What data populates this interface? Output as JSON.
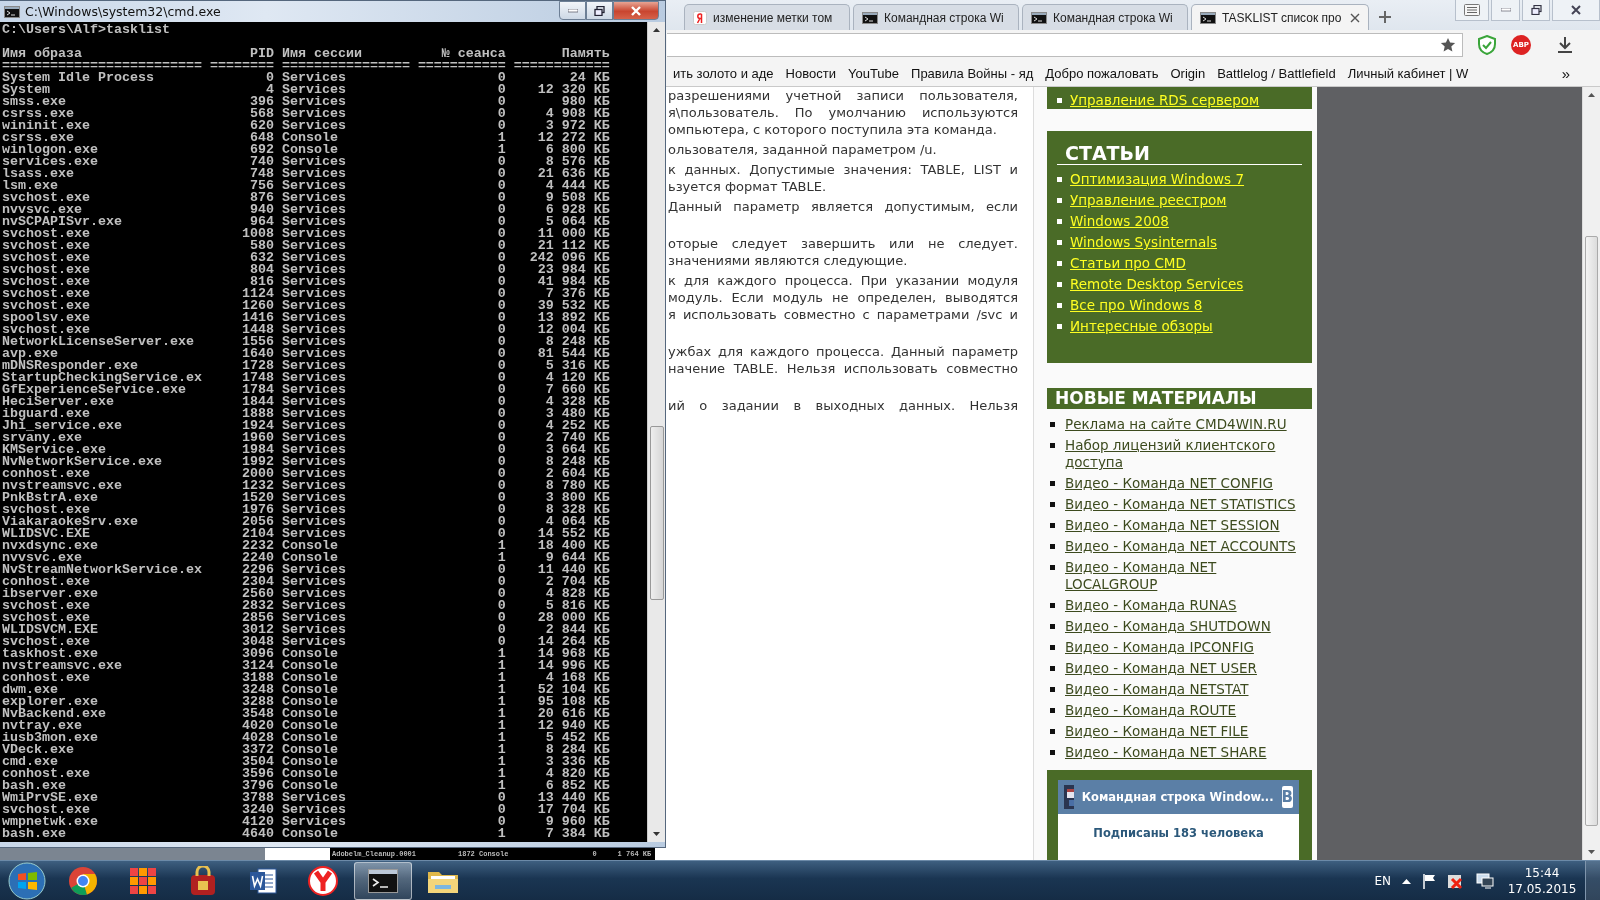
{
  "cmd_window": {
    "title": "C:\\Windows\\system32\\cmd.exe",
    "prompt": "C:\\Users\\Alf>tasklist",
    "columns": [
      "Имя образа",
      "PID",
      "Имя сессии",
      "№ сеанса",
      "Память"
    ],
    "separators": [
      "=========================",
      "========",
      "================",
      "===========",
      "============"
    ],
    "rows": [
      {
        "image": "System Idle Process",
        "pid": "0",
        "session": "Services",
        "session_no": "0",
        "memory": "24 КБ"
      },
      {
        "image": "System",
        "pid": "4",
        "session": "Services",
        "session_no": "0",
        "memory": "12 320 КБ"
      },
      {
        "image": "smss.exe",
        "pid": "396",
        "session": "Services",
        "session_no": "0",
        "memory": "980 КБ"
      },
      {
        "image": "csrss.exe",
        "pid": "568",
        "session": "Services",
        "session_no": "0",
        "memory": "4 908 КБ"
      },
      {
        "image": "wininit.exe",
        "pid": "620",
        "session": "Services",
        "session_no": "0",
        "memory": "3 972 КБ"
      },
      {
        "image": "csrss.exe",
        "pid": "648",
        "session": "Console",
        "session_no": "1",
        "memory": "12 272 КБ"
      },
      {
        "image": "winlogon.exe",
        "pid": "692",
        "session": "Console",
        "session_no": "1",
        "memory": "6 800 КБ"
      },
      {
        "image": "services.exe",
        "pid": "740",
        "session": "Services",
        "session_no": "0",
        "memory": "8 576 КБ"
      },
      {
        "image": "lsass.exe",
        "pid": "748",
        "session": "Services",
        "session_no": "0",
        "memory": "21 636 КБ"
      },
      {
        "image": "lsm.exe",
        "pid": "756",
        "session": "Services",
        "session_no": "0",
        "memory": "4 444 КБ"
      },
      {
        "image": "svchost.exe",
        "pid": "876",
        "session": "Services",
        "session_no": "0",
        "memory": "9 508 КБ"
      },
      {
        "image": "nvvsvc.exe",
        "pid": "940",
        "session": "Services",
        "session_no": "0",
        "memory": "6 928 КБ"
      },
      {
        "image": "nvSCPAPISvr.exe",
        "pid": "964",
        "session": "Services",
        "session_no": "0",
        "memory": "5 064 КБ"
      },
      {
        "image": "svchost.exe",
        "pid": "1008",
        "session": "Services",
        "session_no": "0",
        "memory": "11 000 КБ"
      },
      {
        "image": "svchost.exe",
        "pid": "580",
        "session": "Services",
        "session_no": "0",
        "memory": "21 112 КБ"
      },
      {
        "image": "svchost.exe",
        "pid": "632",
        "session": "Services",
        "session_no": "0",
        "memory": "242 096 КБ"
      },
      {
        "image": "svchost.exe",
        "pid": "804",
        "session": "Services",
        "session_no": "0",
        "memory": "23 984 КБ"
      },
      {
        "image": "svchost.exe",
        "pid": "816",
        "session": "Services",
        "session_no": "0",
        "memory": "41 984 КБ"
      },
      {
        "image": "svchost.exe",
        "pid": "1124",
        "session": "Services",
        "session_no": "0",
        "memory": "7 376 КБ"
      },
      {
        "image": "svchost.exe",
        "pid": "1260",
        "session": "Services",
        "session_no": "0",
        "memory": "39 532 КБ"
      },
      {
        "image": "spoolsv.exe",
        "pid": "1416",
        "session": "Services",
        "session_no": "0",
        "memory": "13 892 КБ"
      },
      {
        "image": "svchost.exe",
        "pid": "1448",
        "session": "Services",
        "session_no": "0",
        "memory": "12 004 КБ"
      },
      {
        "image": "NetworkLicenseServer.exe",
        "pid": "1556",
        "session": "Services",
        "session_no": "0",
        "memory": "8 248 КБ"
      },
      {
        "image": "avp.exe",
        "pid": "1640",
        "session": "Services",
        "session_no": "0",
        "memory": "81 544 КБ"
      },
      {
        "image": "mDNSResponder.exe",
        "pid": "1728",
        "session": "Services",
        "session_no": "0",
        "memory": "5 316 КБ"
      },
      {
        "image": "StartupCheckingService.ex",
        "pid": "1748",
        "session": "Services",
        "session_no": "0",
        "memory": "4 120 КБ"
      },
      {
        "image": "GfExperienceService.exe",
        "pid": "1784",
        "session": "Services",
        "session_no": "0",
        "memory": "7 660 КБ"
      },
      {
        "image": "HeciServer.exe",
        "pid": "1844",
        "session": "Services",
        "session_no": "0",
        "memory": "4 328 КБ"
      },
      {
        "image": "ibguard.exe",
        "pid": "1888",
        "session": "Services",
        "session_no": "0",
        "memory": "3 480 КБ"
      },
      {
        "image": "Jhi_service.exe",
        "pid": "1924",
        "session": "Services",
        "session_no": "0",
        "memory": "4 252 КБ"
      },
      {
        "image": "srvany.exe",
        "pid": "1960",
        "session": "Services",
        "session_no": "0",
        "memory": "2 740 КБ"
      },
      {
        "image": "KMService.exe",
        "pid": "1984",
        "session": "Services",
        "session_no": "0",
        "memory": "3 664 КБ"
      },
      {
        "image": "NvNetworkService.exe",
        "pid": "1992",
        "session": "Services",
        "session_no": "0",
        "memory": "8 248 КБ"
      },
      {
        "image": "conhost.exe",
        "pid": "2000",
        "session": "Services",
        "session_no": "0",
        "memory": "2 604 КБ"
      },
      {
        "image": "nvstreamsvc.exe",
        "pid": "1232",
        "session": "Services",
        "session_no": "0",
        "memory": "8 780 КБ"
      },
      {
        "image": "PnkBstrA.exe",
        "pid": "1520",
        "session": "Services",
        "session_no": "0",
        "memory": "3 800 КБ"
      },
      {
        "image": "svchost.exe",
        "pid": "1976",
        "session": "Services",
        "session_no": "0",
        "memory": "8 328 КБ"
      },
      {
        "image": "ViakaraokeSrv.exe",
        "pid": "2056",
        "session": "Services",
        "session_no": "0",
        "memory": "4 064 КБ"
      },
      {
        "image": "WLIDSVC.EXE",
        "pid": "2104",
        "session": "Services",
        "session_no": "0",
        "memory": "14 552 КБ"
      },
      {
        "image": "nvxdsync.exe",
        "pid": "2232",
        "session": "Console",
        "session_no": "1",
        "memory": "18 400 КБ"
      },
      {
        "image": "nvvsvc.exe",
        "pid": "2240",
        "session": "Console",
        "session_no": "1",
        "memory": "9 644 КБ"
      },
      {
        "image": "NvStreamNetworkService.ex",
        "pid": "2296",
        "session": "Services",
        "session_no": "0",
        "memory": "11 440 КБ"
      },
      {
        "image": "conhost.exe",
        "pid": "2304",
        "session": "Services",
        "session_no": "0",
        "memory": "2 704 КБ"
      },
      {
        "image": "ibserver.exe",
        "pid": "2560",
        "session": "Services",
        "session_no": "0",
        "memory": "4 828 КБ"
      },
      {
        "image": "svchost.exe",
        "pid": "2832",
        "session": "Services",
        "session_no": "0",
        "memory": "5 816 КБ"
      },
      {
        "image": "svchost.exe",
        "pid": "2856",
        "session": "Services",
        "session_no": "0",
        "memory": "28 000 КБ"
      },
      {
        "image": "WLIDSVCM.EXE",
        "pid": "3012",
        "session": "Services",
        "session_no": "0",
        "memory": "2 844 КБ"
      },
      {
        "image": "svchost.exe",
        "pid": "3048",
        "session": "Services",
        "session_no": "0",
        "memory": "14 264 КБ"
      },
      {
        "image": "taskhost.exe",
        "pid": "3096",
        "session": "Console",
        "session_no": "1",
        "memory": "14 968 КБ"
      },
      {
        "image": "nvstreamsvc.exe",
        "pid": "3124",
        "session": "Console",
        "session_no": "1",
        "memory": "14 996 КБ"
      },
      {
        "image": "conhost.exe",
        "pid": "3188",
        "session": "Console",
        "session_no": "1",
        "memory": "4 168 КБ"
      },
      {
        "image": "dwm.exe",
        "pid": "3248",
        "session": "Console",
        "session_no": "1",
        "memory": "52 104 КБ"
      },
      {
        "image": "explorer.exe",
        "pid": "3288",
        "session": "Console",
        "session_no": "1",
        "memory": "95 108 КБ"
      },
      {
        "image": "NvBackend.exe",
        "pid": "3548",
        "session": "Console",
        "session_no": "1",
        "memory": "20 616 КБ"
      },
      {
        "image": "nvtray.exe",
        "pid": "4020",
        "session": "Console",
        "session_no": "1",
        "memory": "12 940 КБ"
      },
      {
        "image": "iusb3mon.exe",
        "pid": "4028",
        "session": "Console",
        "session_no": "1",
        "memory": "5 452 КБ"
      },
      {
        "image": "VDeck.exe",
        "pid": "3372",
        "session": "Console",
        "session_no": "1",
        "memory": "8 284 КБ"
      },
      {
        "image": "cmd.exe",
        "pid": "3504",
        "session": "Console",
        "session_no": "1",
        "memory": "3 336 КБ"
      },
      {
        "image": "conhost.exe",
        "pid": "3596",
        "session": "Console",
        "session_no": "1",
        "memory": "4 820 КБ"
      },
      {
        "image": "bash.exe",
        "pid": "3796",
        "session": "Console",
        "session_no": "1",
        "memory": "6 852 КБ"
      },
      {
        "image": "WmiPrvSE.exe",
        "pid": "3788",
        "session": "Services",
        "session_no": "0",
        "memory": "13 440 КБ"
      },
      {
        "image": "svchost.exe",
        "pid": "3240",
        "session": "Services",
        "session_no": "0",
        "memory": "17 704 КБ"
      },
      {
        "image": "wmpnetwk.exe",
        "pid": "4120",
        "session": "Services",
        "session_no": "0",
        "memory": "9 960 КБ"
      },
      {
        "image": "bash.exe",
        "pid": "4640",
        "session": "Console",
        "session_no": "1",
        "memory": "7 384 КБ"
      }
    ]
  },
  "background_console": {
    "image": "Adobelm_Cleanup.0001",
    "pid": "1872",
    "session": "Console",
    "session_no": "0",
    "memory": "1 764 КБ"
  },
  "browser": {
    "tabs": [
      {
        "label": "изменение метки том",
        "kind": "y-logo",
        "selected": false
      },
      {
        "label": "Командная строка Wi",
        "kind": "console",
        "selected": false
      },
      {
        "label": "Командная строка Wi",
        "kind": "console",
        "selected": false
      },
      {
        "label": "TASKLIST список про",
        "kind": "console",
        "selected": true
      }
    ],
    "toolbar": {
      "abp_label": "ABP"
    },
    "bookmarks": [
      "ить золото и аде",
      "Новости",
      "YouTube",
      "Правила Войны - яд",
      "Добро пожаловать",
      "Origin",
      "Battlelog / Battlefield",
      "Личный кабинет | W"
    ],
    "bookmarks_more": "»",
    "article": {
      "paragraphs": [
        {
          "lines": [
            "разрешениями учетной записи пользователя,",
            "я\\пользователь. По умолчанию используются",
            "омпьютера, с которого поступила эта команда."
          ],
          "cut_tail": false
        },
        {
          "lines": [
            "ользователя, заданной параметром /u."
          ],
          "cut_tail": false
        },
        {
          "lines": [
            "к данных. Допустимые значения: TABLE, LIST и",
            "ьзуется формат TABLE."
          ],
          "cut_tail": false
        },
        {
          "lines": [
            "Данный параметр является допустимым, если"
          ],
          "cut_tail": true
        },
        {
          "lines": [
            "оторые следует завершить или не следует.",
            "значениями являются следующие."
          ],
          "cut_tail": false
        },
        {
          "lines": [
            "к для каждого процесса. При указании модуля",
            "модуль. Если модуль не определен, выводятся",
            "я использовать совместно с параметрами /svc и"
          ],
          "cut_tail": true
        },
        {
          "lines": [
            "ужбах для каждого процесса. Данный параметр",
            "начение TABLE. Нельзя использовать совместно"
          ],
          "cut_tail": true
        },
        {
          "lines": [
            "ий о задании в выходных данных. Нельзя"
          ],
          "cut_tail": true
        }
      ]
    },
    "sidebar": {
      "top_link": "Управление RDS сервером",
      "articles": {
        "title": "СТАТЬИ",
        "links": [
          "Оптимизация Windows 7",
          "Управление реестром",
          "Windows 2008",
          "Windows Sysinternals",
          "Статьи про CMD",
          "Remote Desktop Services",
          "Все про Windows 8",
          "Интересные обзоры"
        ]
      },
      "new_materials": {
        "title": "НОВЫЕ МАТЕРИАЛЫ",
        "links": [
          "Реклама на сайте CMD4WIN.RU",
          "Набор лицензий клиентского доступа",
          "Видео - Команда NET CONFIG",
          "Видео - Команда NET STATISTICS",
          "Видео - Команда NET SESSION",
          "Видео - Команда NET ACCOUNTS",
          "Видео - Команда NET LOCALGROUP",
          "Видео - Команда RUNAS",
          "Видео - Команда SHUTDOWN",
          "Видео - Команда IPCONFIG",
          "Видео - Команда NET USER",
          "Видео - Команда NETSTAT",
          "Видео - Команда ROUTE",
          "Видео - Команда NET FILE",
          "Видео - Команда NET SHARE"
        ]
      },
      "widget": {
        "title": "Командная строка Window...",
        "button": "В",
        "subscribers": "Подписаны 183 человека"
      }
    }
  },
  "taskbar": {
    "apps": [
      {
        "kind": "chrome",
        "selected": false
      },
      {
        "kind": "tiles",
        "selected": false
      },
      {
        "kind": "padlock",
        "selected": false
      },
      {
        "kind": "word",
        "selected": false
      },
      {
        "kind": "yandex",
        "selected": false
      },
      {
        "kind": "console",
        "selected": true
      },
      {
        "kind": "folder",
        "selected": false
      }
    ],
    "language": "EN",
    "time": "15:44",
    "date": "17.05.2015"
  }
}
